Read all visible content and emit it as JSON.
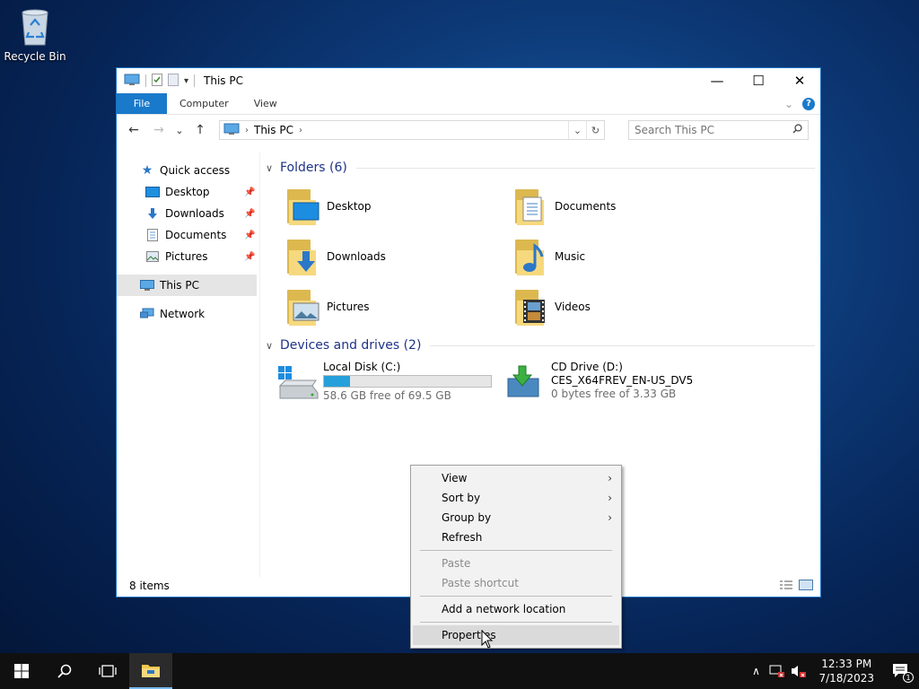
{
  "desktop": {
    "recycle_bin_label": "Recycle Bin"
  },
  "window": {
    "title": "This PC",
    "minimize_glyph": "—",
    "maximize_glyph": "☐",
    "close_glyph": "✕",
    "ribbon_tabs": [
      "File",
      "Computer",
      "View"
    ],
    "help_glyph": "?",
    "collapse_glyph": "⌄"
  },
  "navbar": {
    "back_glyph": "←",
    "forward_glyph": "→",
    "recent_glyph": "⌄",
    "up_glyph": "↑",
    "breadcrumb": [
      "This PC"
    ],
    "search_placeholder": "Search This PC"
  },
  "sidebar": {
    "quick_access": "Quick access",
    "pinned": [
      {
        "label": "Desktop"
      },
      {
        "label": "Downloads"
      },
      {
        "label": "Documents"
      },
      {
        "label": "Pictures"
      }
    ],
    "this_pc": "This PC",
    "network": "Network"
  },
  "content": {
    "folders_header": "Folders (6)",
    "folders": [
      {
        "label": "Desktop",
        "icon": "desktop-overlay"
      },
      {
        "label": "Documents",
        "icon": "document-overlay"
      },
      {
        "label": "Downloads",
        "icon": "download-arrow-overlay"
      },
      {
        "label": "Music",
        "icon": "music-note-overlay"
      },
      {
        "label": "Pictures",
        "icon": "picture-overlay"
      },
      {
        "label": "Videos",
        "icon": "film-overlay"
      }
    ],
    "drives_header": "Devices and drives (2)",
    "drives": [
      {
        "name": "Local Disk (C:)",
        "free_text": "58.6 GB free of 69.5 GB",
        "used_fraction": 0.157
      },
      {
        "name": "CD Drive (D:)",
        "volume": "CES_X64FREV_EN-US_DV5",
        "free_text": "0 bytes free of 3.33 GB"
      }
    ]
  },
  "statusbar": {
    "item_count": "8 items"
  },
  "context_menu": {
    "items": [
      {
        "label": "View",
        "submenu": true,
        "enabled": true
      },
      {
        "label": "Sort by",
        "submenu": true,
        "enabled": true
      },
      {
        "label": "Group by",
        "submenu": true,
        "enabled": true
      },
      {
        "label": "Refresh",
        "submenu": false,
        "enabled": true
      },
      {
        "label": "Paste",
        "submenu": false,
        "enabled": false
      },
      {
        "label": "Paste shortcut",
        "submenu": false,
        "enabled": false
      },
      {
        "label": "Add a network location",
        "submenu": false,
        "enabled": true
      },
      {
        "label": "Properties",
        "submenu": false,
        "enabled": true,
        "highlighted": true
      }
    ]
  },
  "taskbar": {
    "time": "12:33 PM",
    "date": "7/18/2023",
    "notification_count": "1"
  },
  "colors": {
    "accent": "#1979ca",
    "group_header": "#1e3287",
    "drive_bar_fill": "#26a0da"
  }
}
